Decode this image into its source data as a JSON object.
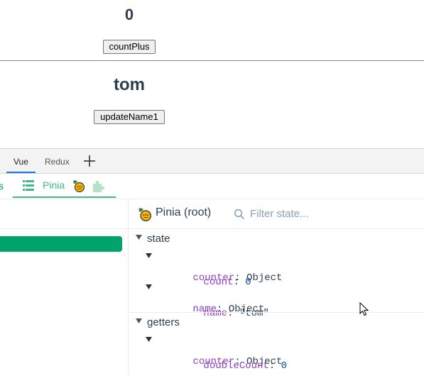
{
  "app": {
    "count_value": "0",
    "count_button": "countPlus",
    "name_value": "tom",
    "name_button": "updateName1"
  },
  "devtools": {
    "tabs": [
      "Vue",
      "Redux"
    ],
    "active_tab": "Vue",
    "vue_tab_prev_fragment": "s",
    "vue_tab_pinia": "Pinia",
    "inspector_title": "Pinia (root)",
    "filter_placeholder": "Filter state...",
    "sections": {
      "state": {
        "label": "state",
        "items": [
          {
            "key": "counter",
            "type": "Object",
            "children": [
              {
                "key": "count",
                "value": "0"
              }
            ]
          },
          {
            "key": "name",
            "type": "Object",
            "children": [
              {
                "key": "name",
                "value": "\"tom\""
              }
            ]
          }
        ]
      },
      "getters": {
        "label": "getters",
        "items": [
          {
            "key": "counter",
            "type": "Object",
            "children": [
              {
                "key": "doubleCount",
                "value": "0"
              }
            ]
          }
        ]
      }
    },
    "colors": {
      "accent_green": "#42b883",
      "store_highlight": "#00a36c",
      "key_purple": "#8b3fbf",
      "number_blue": "#0d47a1",
      "tab_underline": "#1a73e8"
    }
  }
}
